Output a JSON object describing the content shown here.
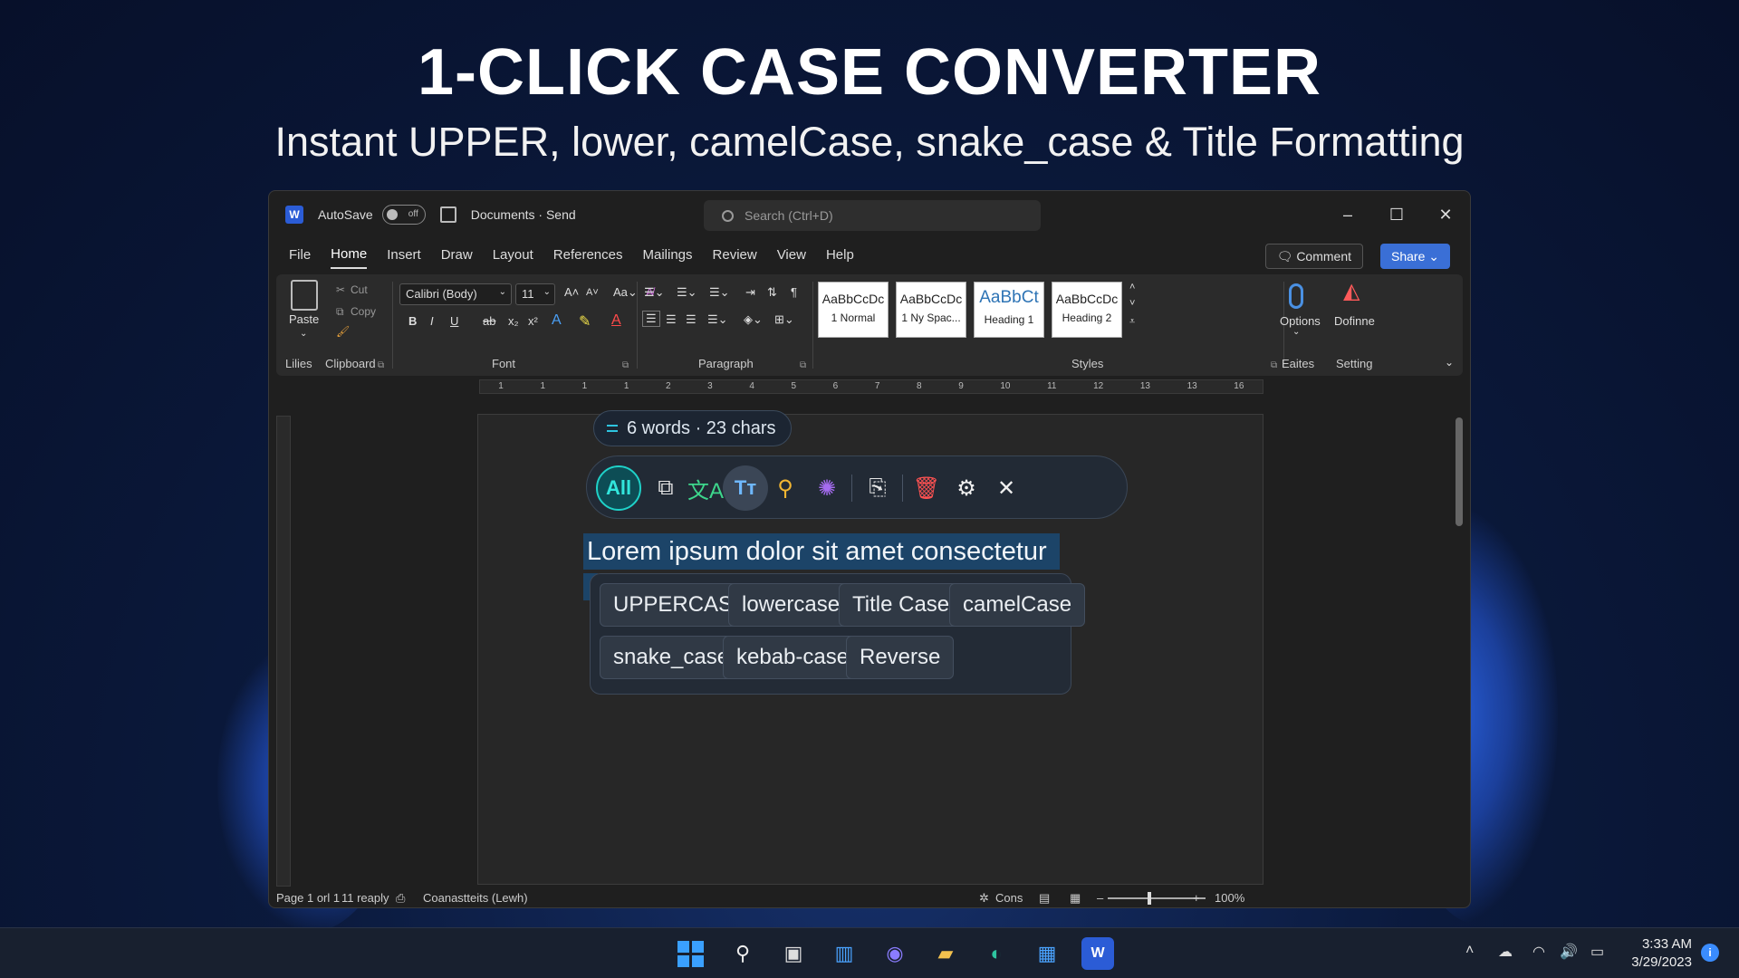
{
  "headline": {
    "title": "1-CLICK CASE CONVERTER",
    "subtitle": "Instant UPPER, lower, camelCase, snake_case & Title Formatting"
  },
  "titlebar": {
    "app_logo": "W",
    "autosave_label": "AutoSave",
    "autosave_state": "off",
    "doc_title": "Documents · Send",
    "search_placeholder": "Search (Ctrl+D)",
    "minimize": "–",
    "maximize": "☐",
    "close": "✕"
  },
  "menu": {
    "tabs": [
      "File",
      "Home",
      "Insert",
      "Draw",
      "Layout",
      "References",
      "Mailings",
      "Review",
      "View",
      "Help"
    ],
    "active_tab": "Home",
    "comment_label": "Comment",
    "share_label": "Share"
  },
  "ribbon": {
    "paste_label": "Paste",
    "cut_label": "Cut",
    "copy_label": "Copy",
    "lilies_label": "Lilies",
    "clipboard_label": "Clipboard",
    "font_name": "Calibri (Body)",
    "font_size": "11",
    "font_label": "Font",
    "paragraph_label": "Paragraph",
    "styles": [
      {
        "preview": "AaBbCcDc",
        "name": "1 Normal"
      },
      {
        "preview": "AaBbCcDc",
        "name": "1 Ny Spac..."
      },
      {
        "preview": "AaBbCt",
        "name": "Heading 1"
      },
      {
        "preview": "AaBbCcDc",
        "name": "Heading 2"
      }
    ],
    "styles_label": "Styles",
    "options_label": "Options",
    "dofinne_label": "Dofinne",
    "eaites_label": "Eaites",
    "setting_label": "Setting"
  },
  "ruler_numbers": [
    "1",
    "1",
    "1",
    "1",
    "2",
    "3",
    "4",
    "5",
    "6",
    "7",
    "8",
    "9",
    "10",
    "11",
    "12",
    "13",
    "13",
    "16"
  ],
  "converter": {
    "count_text": "6 words · 23 chars",
    "all_label": "All",
    "tt_label": "Tт",
    "selected_text": "Lorem ipsum dolor sit amet consectetur",
    "case_options": [
      "UPPERCASE",
      "lowercase",
      "Title Case",
      "camelCase",
      "snake_case",
      "kebab-case",
      "Reverse"
    ]
  },
  "statusbar": {
    "page": "Page 1 orl 1",
    "words": "11 reaply",
    "lang": "Coanastteits (Lewh)",
    "focus": "Cons",
    "zoom_minus": "–",
    "zoom_plus": "+",
    "zoom": "100%"
  },
  "taskbar": {
    "time": "3:33 AM",
    "date": "3/29/2023",
    "notif": "i"
  },
  "colors": {
    "accent": "#1fd1c8",
    "selection": "#1c4468",
    "share": "#3a6fd6"
  }
}
